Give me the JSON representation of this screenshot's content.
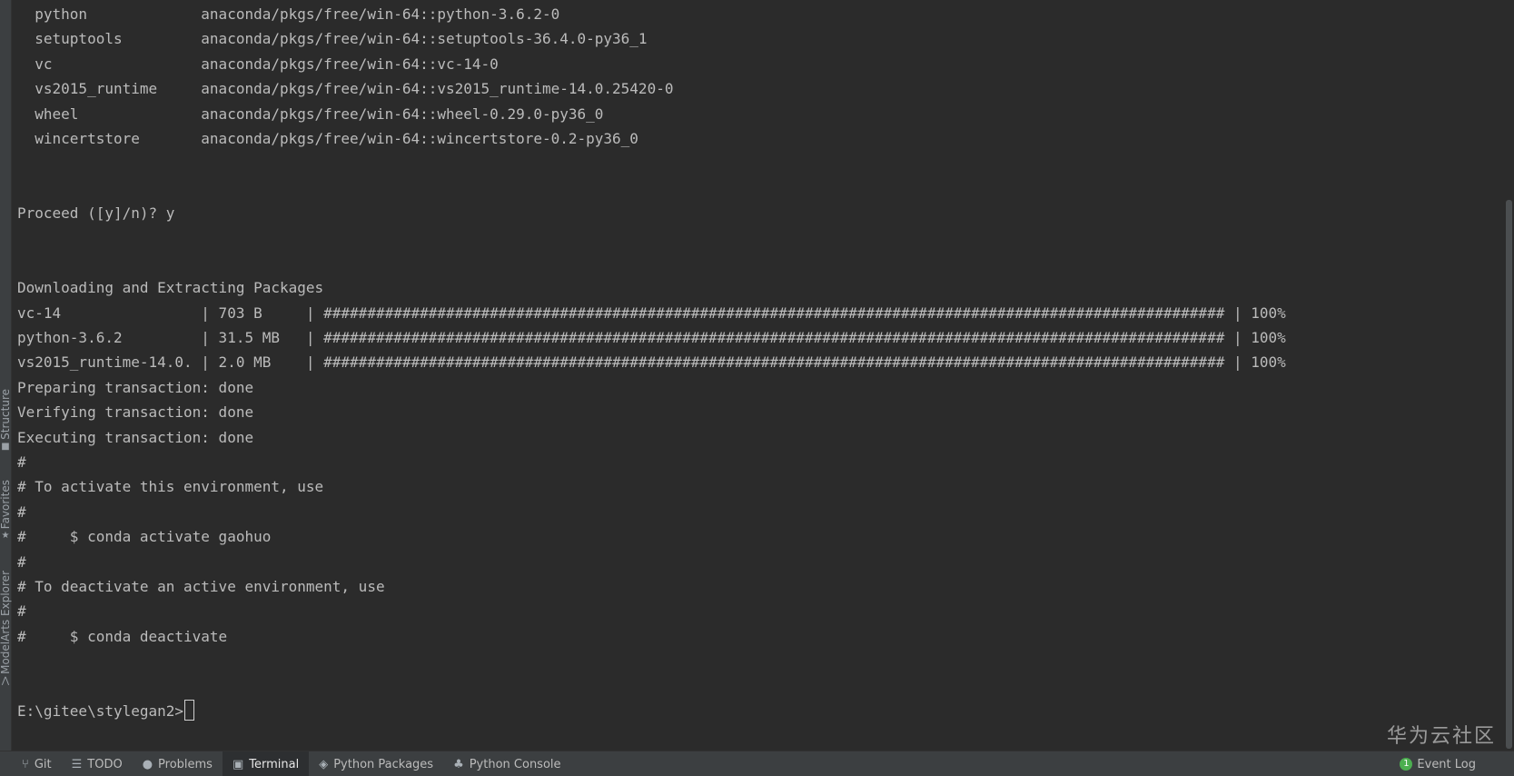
{
  "terminal": {
    "lines": [
      "  python             anaconda/pkgs/free/win-64::python-3.6.2-0",
      "  setuptools         anaconda/pkgs/free/win-64::setuptools-36.4.0-py36_1",
      "  vc                 anaconda/pkgs/free/win-64::vc-14-0",
      "  vs2015_runtime     anaconda/pkgs/free/win-64::vs2015_runtime-14.0.25420-0",
      "  wheel              anaconda/pkgs/free/win-64::wheel-0.29.0-py36_0",
      "  wincertstore       anaconda/pkgs/free/win-64::wincertstore-0.2-py36_0",
      "",
      "",
      "Proceed ([y]/n)? y",
      "",
      "",
      "Downloading and Extracting Packages",
      "vc-14                | 703 B     | ####################################################################################################### | 100%",
      "python-3.6.2         | 31.5 MB   | ####################################################################################################### | 100%",
      "vs2015_runtime-14.0. | 2.0 MB    | ####################################################################################################### | 100%",
      "Preparing transaction: done",
      "Verifying transaction: done",
      "Executing transaction: done",
      "#",
      "# To activate this environment, use",
      "#",
      "#     $ conda activate gaohuo",
      "#",
      "# To deactivate an active environment, use",
      "#",
      "#     $ conda deactivate",
      "",
      "",
      "E:\\gitee\\stylegan2>"
    ]
  },
  "sidebar": {
    "tabs": [
      {
        "label": "Structure",
        "icon": "structure-icon",
        "glyph": "■"
      },
      {
        "label": "Favorites",
        "icon": "star-icon",
        "glyph": "★"
      },
      {
        "label": "ModelArts Explorer",
        "icon": "modelarts-icon",
        "glyph": "⋀"
      }
    ]
  },
  "bottom_bar": {
    "tabs": [
      {
        "label": "Git",
        "icon": "git-branch-icon",
        "glyph": "⑂"
      },
      {
        "label": "TODO",
        "icon": "todo-list-icon",
        "glyph": "☰"
      },
      {
        "label": "Problems",
        "icon": "problems-icon",
        "glyph": "●"
      },
      {
        "label": "Terminal",
        "icon": "terminal-icon",
        "glyph": "▣"
      },
      {
        "label": "Python Packages",
        "icon": "layers-icon",
        "glyph": "◈"
      },
      {
        "label": "Python Console",
        "icon": "python-icon",
        "glyph": "♣"
      }
    ],
    "active_tab": "Terminal",
    "event_log": {
      "label": "Event Log",
      "count": "1"
    }
  },
  "watermark": "华为云社区",
  "colors": {
    "background": "#2b2b2b",
    "text": "#bbbbbb",
    "toolbar": "#3c3f41",
    "badge": "#4caf50"
  }
}
